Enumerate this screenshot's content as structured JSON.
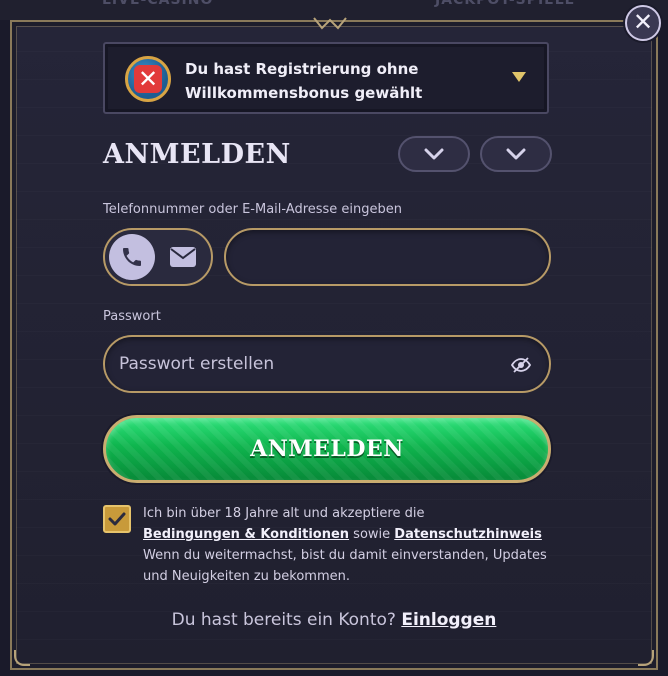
{
  "background": {
    "tab_left": "LIVE-CASINO",
    "tab_right": "JACKPOT-SPIELE"
  },
  "bonus": {
    "line1": "Du hast Registrierung ohne",
    "line2": "Willkommensbonus gewählt"
  },
  "title": "ANMELDEN",
  "contact": {
    "label": "Telefonnummer oder E-Mail-Adresse eingeben",
    "value": "",
    "mode": "phone"
  },
  "password": {
    "label": "Passwort",
    "placeholder": "Passwort erstellen"
  },
  "submit_label": "ANMELDEN",
  "terms": {
    "checked": true,
    "text1": "Ich bin über 18 Jahre alt und akzeptiere die",
    "link_terms": "Bedingungen & Konditionen",
    "text2": " sowie ",
    "link_privacy": "Datenschutzhinweis",
    "text3": " Wenn du weitermachst, bist du damit einverstanden, Updates und Neuigkeiten zu bekommen."
  },
  "footer": {
    "question": "Du hast bereits ein Konto? ",
    "login_link": "Einloggen"
  },
  "colors": {
    "accent_gold": "#b79a66",
    "submit_green": "#0fb54e",
    "panel_bg": "#20202f"
  }
}
